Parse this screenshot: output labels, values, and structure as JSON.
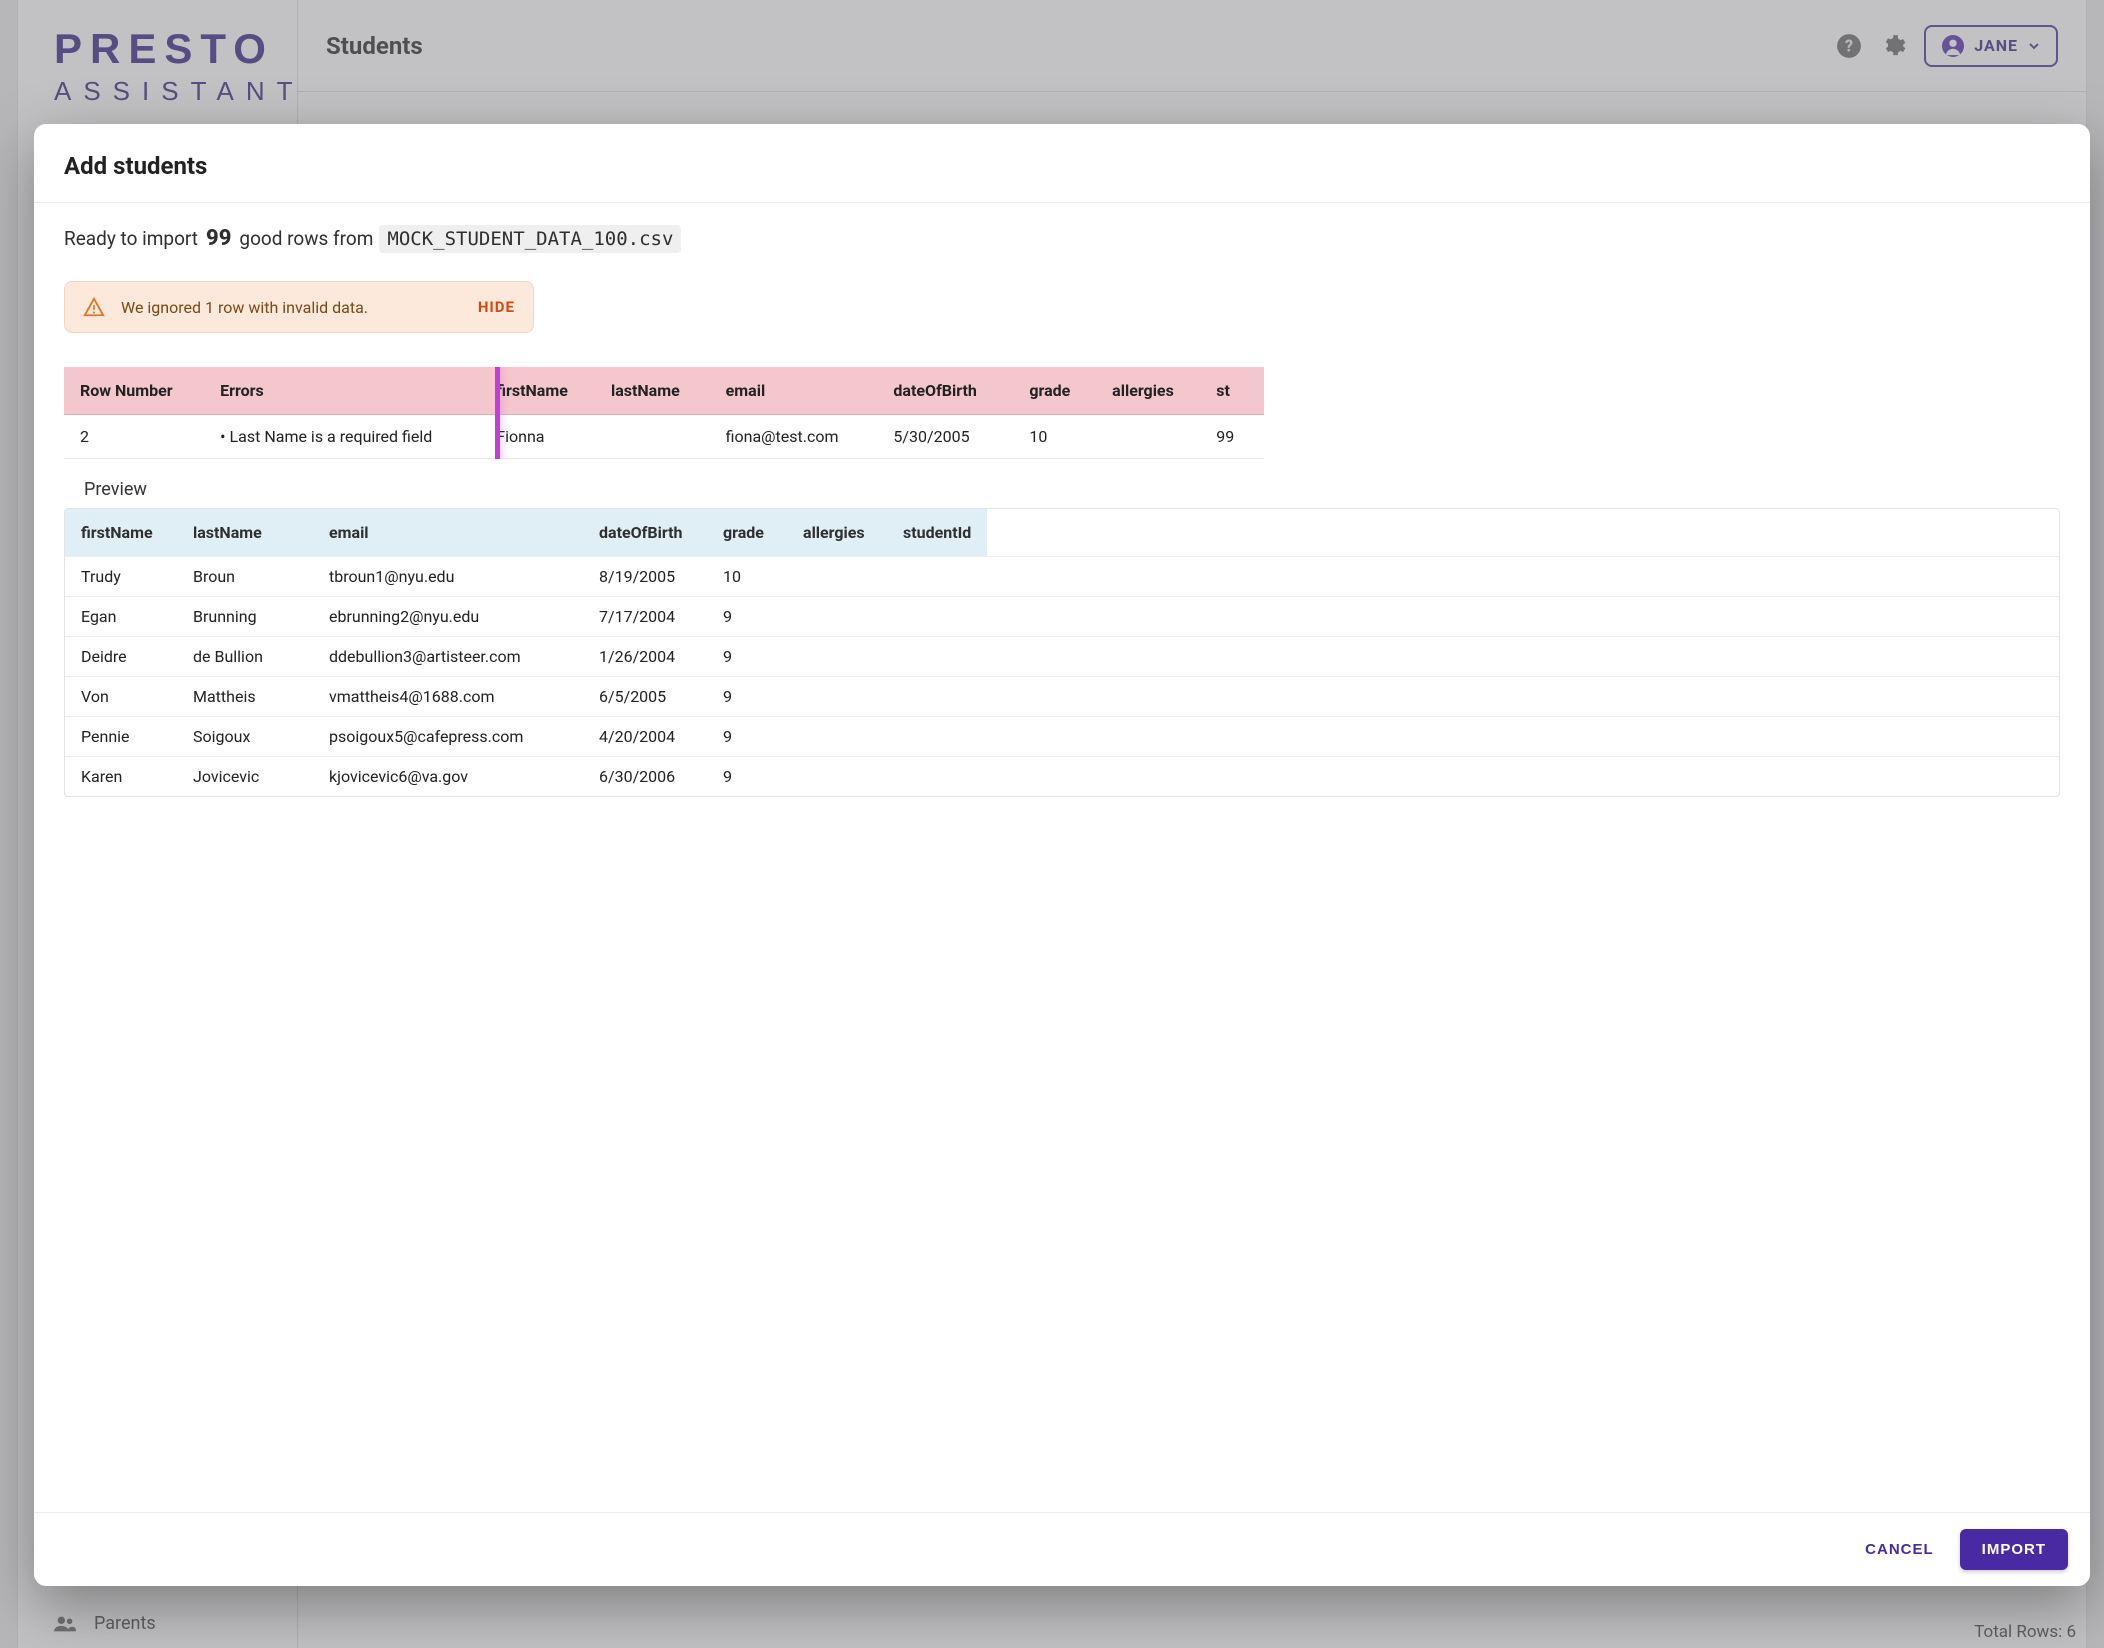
{
  "header": {
    "page_title": "Students",
    "user_name": "JANE"
  },
  "logo": {
    "top": "PRESTO",
    "sub": "ASSISTANT"
  },
  "sidebar": {
    "items": [
      {
        "label": "Parents"
      }
    ]
  },
  "footer": {
    "total_rows_label": "Total Rows:",
    "total_rows_value": "6"
  },
  "dialog": {
    "title": "Add students",
    "ready_prefix": "Ready to import",
    "good_rows": "99",
    "ready_mid": "good rows from",
    "filename": "MOCK_STUDENT_DATA_100.csv",
    "warning": {
      "text": "We ignored 1 row with invalid data.",
      "hide": "HIDE"
    },
    "errors": {
      "headers": {
        "row_number": "Row Number",
        "errors": "Errors",
        "firstName": "firstName",
        "lastName": "lastName",
        "email": "email",
        "dateOfBirth": "dateOfBirth",
        "grade": "grade",
        "allergies": "allergies",
        "studentId": "st"
      },
      "rows": [
        {
          "row_number": "2",
          "error": "• Last Name is a required field",
          "firstName": "Fionna",
          "lastName": "",
          "email": "fiona@test.com",
          "dateOfBirth": "5/30/2005",
          "grade": "10",
          "allergies": "",
          "studentId": "99"
        }
      ]
    },
    "preview": {
      "label": "Preview",
      "headers": {
        "firstName": "firstName",
        "lastName": "lastName",
        "email": "email",
        "dateOfBirth": "dateOfBirth",
        "grade": "grade",
        "allergies": "allergies",
        "studentId": "studentId"
      },
      "rows": [
        {
          "firstName": "Trudy",
          "lastName": "Broun",
          "email": "tbroun1@nyu.edu",
          "dateOfBirth": "8/19/2005",
          "grade": "10",
          "allergies": "",
          "studentId": ""
        },
        {
          "firstName": "Egan",
          "lastName": "Brunning",
          "email": "ebrunning2@nyu.edu",
          "dateOfBirth": "7/17/2004",
          "grade": "9",
          "allergies": "",
          "studentId": ""
        },
        {
          "firstName": "Deidre",
          "lastName": "de Bullion",
          "email": "ddebullion3@artisteer.com",
          "dateOfBirth": "1/26/2004",
          "grade": "9",
          "allergies": "",
          "studentId": ""
        },
        {
          "firstName": "Von",
          "lastName": "Mattheis",
          "email": "vmattheis4@1688.com",
          "dateOfBirth": "6/5/2005",
          "grade": "9",
          "allergies": "",
          "studentId": ""
        },
        {
          "firstName": "Pennie",
          "lastName": "Soigoux",
          "email": "psoigoux5@cafepress.com",
          "dateOfBirth": "4/20/2004",
          "grade": "9",
          "allergies": "",
          "studentId": ""
        },
        {
          "firstName": "Karen",
          "lastName": "Jovicevic",
          "email": "kjovicevic6@va.gov",
          "dateOfBirth": "6/30/2006",
          "grade": "9",
          "allergies": "",
          "studentId": ""
        }
      ]
    },
    "actions": {
      "cancel": "CANCEL",
      "import": "IMPORT"
    }
  }
}
